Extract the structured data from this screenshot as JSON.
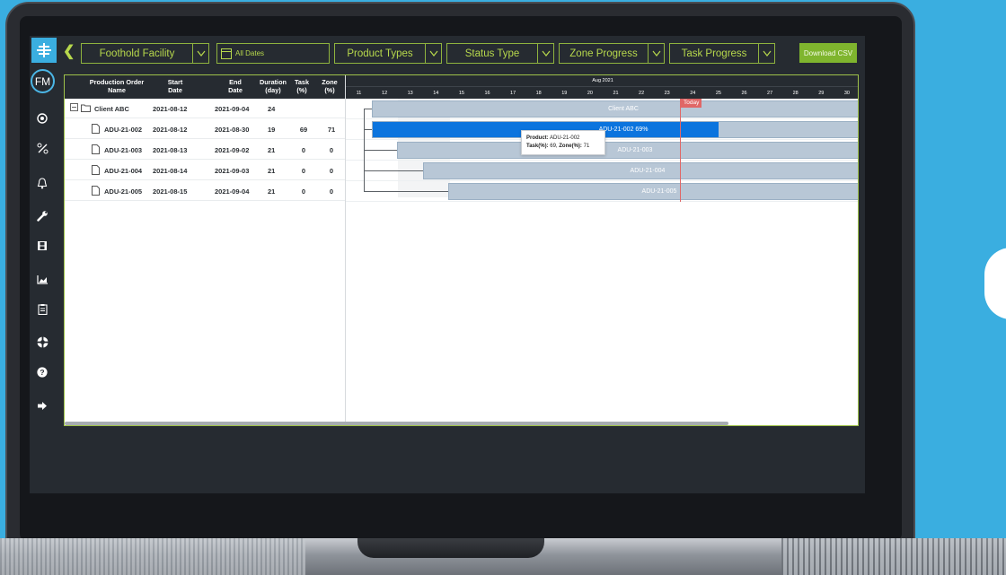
{
  "app": {
    "avatar": "FM",
    "facility": "Foothold Facility",
    "dates": "All Dates",
    "product_types": "Product Types",
    "status_type": "Status Type",
    "zone_progress": "Zone Progress",
    "task_progress": "Task Progress",
    "download_csv": "Download CSV"
  },
  "colors": {
    "accent": "#b7d84c",
    "bar": "#b8c7d6",
    "bar_fill": "#0b74de",
    "today": "#e06767",
    "background": "#3aaee0"
  },
  "sidebar_icons": [
    "target-icon",
    "percent-icon",
    "bell-icon",
    "wrench-icon",
    "film-icon",
    "chart-icon",
    "clipboard-icon",
    "lifebuoy-icon",
    "help-icon",
    "logout-icon"
  ],
  "grid": {
    "headers": {
      "name": "Production Order Name",
      "start": "Start Date",
      "end": "End Date",
      "duration": "Duration (day)",
      "task": "Task (%)",
      "zone": "Zone (%)"
    },
    "rows": [
      {
        "name": "Client ABC",
        "start": "2021-08-12",
        "end": "2021-09-04",
        "duration": "24",
        "task": "",
        "zone": ""
      },
      {
        "name": "ADU-21-002",
        "start": "2021-08-12",
        "end": "2021-08-30",
        "duration": "19",
        "task": "69",
        "zone": "71"
      },
      {
        "name": "ADU-21-003",
        "start": "2021-08-13",
        "end": "2021-09-02",
        "duration": "21",
        "task": "0",
        "zone": "0"
      },
      {
        "name": "ADU-21-004",
        "start": "2021-08-14",
        "end": "2021-09-03",
        "duration": "21",
        "task": "0",
        "zone": "0"
      },
      {
        "name": "ADU-21-005",
        "start": "2021-08-15",
        "end": "2021-09-04",
        "duration": "21",
        "task": "0",
        "zone": "0"
      }
    ]
  },
  "gantt": {
    "month": "Aug 2021",
    "days": [
      "11",
      "12",
      "13",
      "14",
      "15",
      "16",
      "17",
      "18",
      "19",
      "20",
      "21",
      "22",
      "23",
      "24",
      "25",
      "26",
      "27",
      "28",
      "29",
      "30"
    ],
    "today_label": "Today",
    "bars": [
      {
        "label": "Client ABC",
        "progress": 0
      },
      {
        "label": "ADU-21-002 69%",
        "progress": 0.69
      },
      {
        "label": "ADU-21-003",
        "progress": 0
      },
      {
        "label": "ADU-21-004",
        "progress": 0
      },
      {
        "label": "ADU-21-005",
        "progress": 0
      }
    ],
    "tooltip": {
      "product_key": "Product:",
      "product_val": "ADU-21-002",
      "task_key": "Task(%):",
      "task_val": "69",
      "zone_key": "Zone(%):",
      "zone_val": "71"
    }
  }
}
